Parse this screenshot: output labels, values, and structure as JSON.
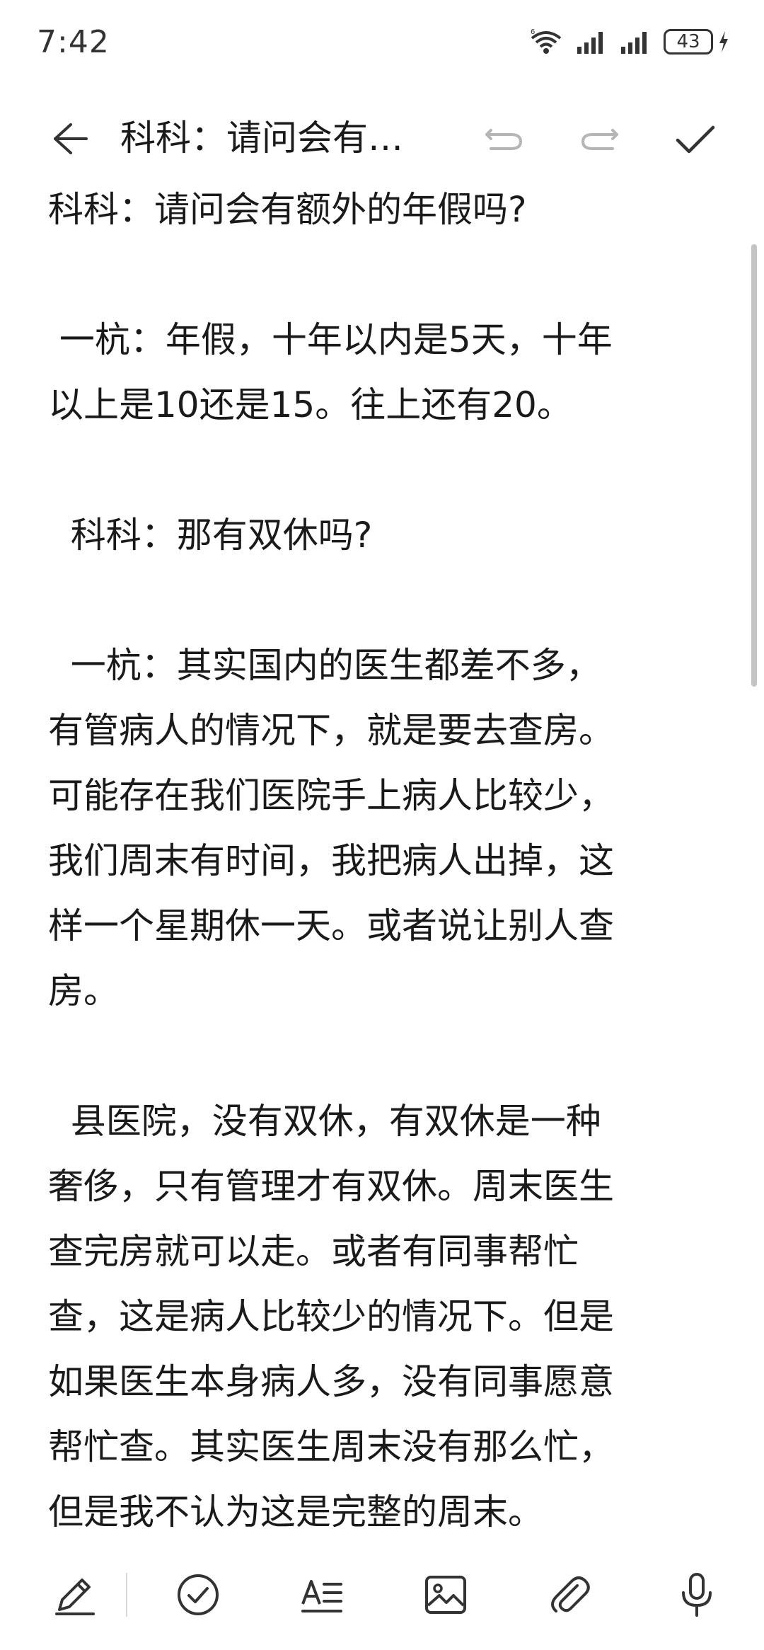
{
  "status_bar": {
    "time": "7:42",
    "battery": "43",
    "icons": [
      "wifi-icon",
      "signal-icon",
      "signal-icon",
      "battery-icon",
      "charging-icon"
    ]
  },
  "toolbar": {
    "title": "科科：请问会有…",
    "icons": [
      "back-arrow-icon",
      "undo-icon",
      "redo-icon",
      "checkmark-icon"
    ]
  },
  "note": {
    "lines": [
      "科科：请问会有额外的年假吗?",
      "",
      " 一杭：年假，十年以内是5天，十年",
      "以上是10还是15。往上还有20。",
      "",
      "  科科：那有双休吗?",
      "",
      "  一杭：其实国内的医生都差不多，",
      "有管病人的情况下，就是要去查房。",
      "可能存在我们医院手上病人比较少，",
      "我们周末有时间，我把病人出掉，这",
      "样一个星期休一天。或者说让别人查",
      "房。",
      "",
      "  县医院，没有双休，有双休是一种",
      "奢侈，只有管理才有双休。周末医生",
      "查完房就可以走。或者有同事帮忙",
      "查，这是病人比较少的情况下。但是",
      "如果医生本身病人多，没有同事愿意",
      "帮忙查。其实医生周末没有那么忙，",
      "但是我不认为这是完整的周末。"
    ]
  },
  "bottom_toolbar": {
    "icons": [
      "pen-icon",
      "checklist-icon",
      "text-format-icon",
      "image-icon",
      "attachment-icon",
      "microphone-icon"
    ]
  },
  "colors": {
    "text": "#1a1a1a",
    "icon": "#333333",
    "background": "#ffffff",
    "disabled_icon": "#b5b5b5"
  }
}
